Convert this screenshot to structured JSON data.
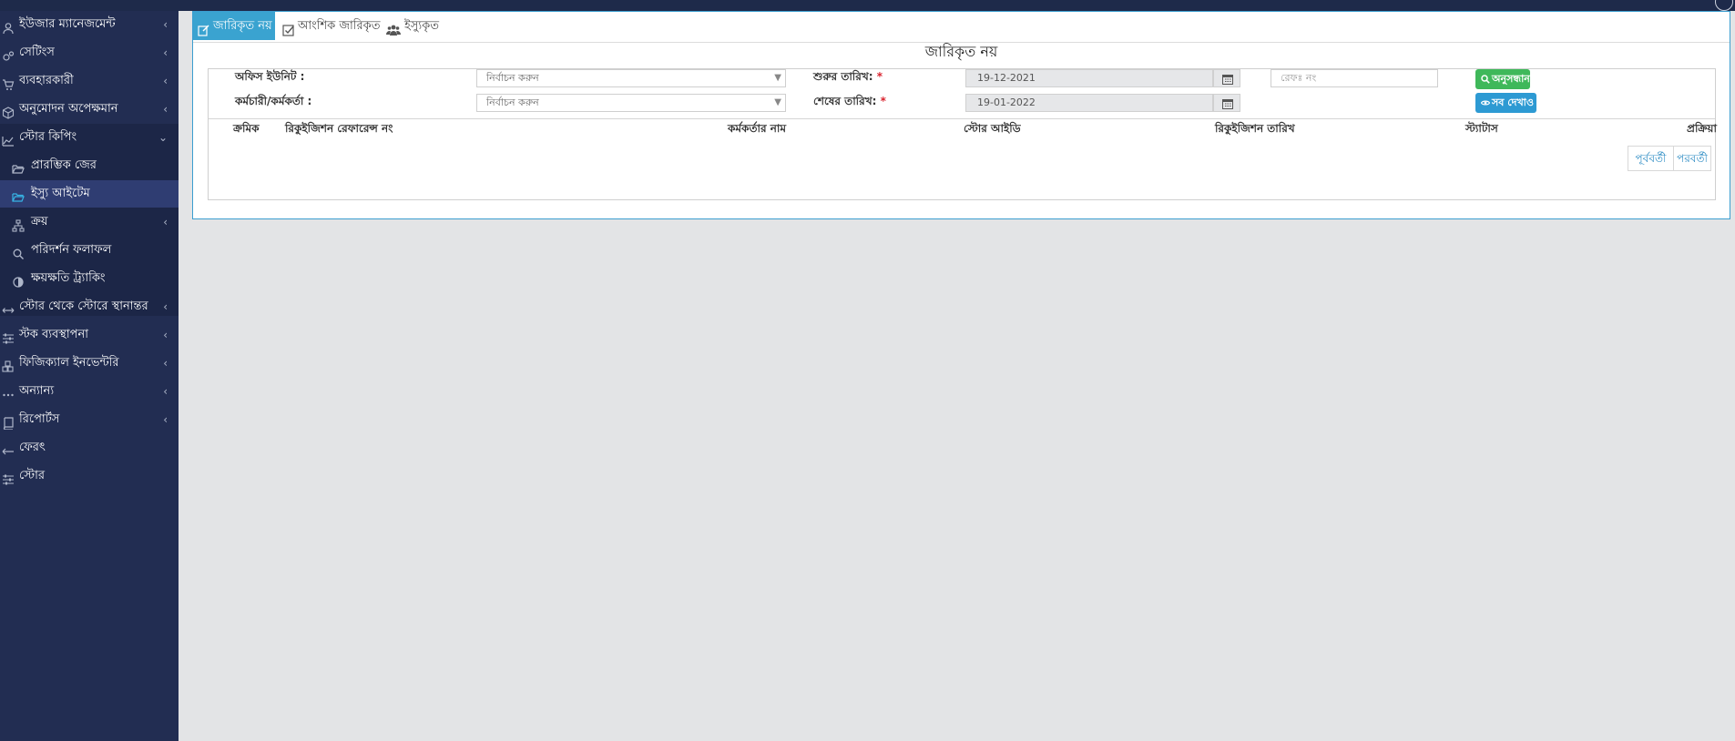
{
  "sidebar": {
    "items": [
      {
        "label": "ইউজার ম্যানেজমেন্ট",
        "icon": "user-icon",
        "chevron": "‹"
      },
      {
        "label": "সেটিংস",
        "icon": "gears-icon",
        "chevron": "‹"
      },
      {
        "label": "ব্যবহারকারী",
        "icon": "cart-icon",
        "chevron": "‹"
      },
      {
        "label": "অনুমোদন অপেক্ষমান",
        "icon": "cube-icon",
        "chevron": "‹"
      },
      {
        "label": "স্টোর কিপিং",
        "icon": "line-chart-icon",
        "chevron": "⌄"
      },
      {
        "label": "প্রারম্ভিক জের",
        "icon": "folder-open-icon"
      },
      {
        "label": "ইস্যু আইটেম",
        "icon": "folder-open-icon"
      },
      {
        "label": "ক্রয়",
        "icon": "sitemap-icon",
        "chevron": "‹"
      },
      {
        "label": "পরিদর্শন ফলাফল",
        "icon": "search-icon"
      },
      {
        "label": "ক্ষয়ক্ষতি ট্র্যাকিং",
        "icon": "adjust-icon"
      },
      {
        "label": "স্টোর থেকে স্টোরে স্থানান্তর",
        "icon": "arrows-h-icon",
        "chevron": "‹"
      },
      {
        "label": "স্টক ব্যবস্থাপনা",
        "icon": "sliders-icon",
        "chevron": "‹"
      },
      {
        "label": "ফিজিক্যাল ইনভেন্টরি",
        "icon": "cubes-icon",
        "chevron": "‹"
      },
      {
        "label": "অন্যান্য",
        "icon": "ellipsis-icon",
        "chevron": "‹"
      },
      {
        "label": "রিপোর্টস",
        "icon": "book-icon",
        "chevron": "‹"
      },
      {
        "label": "ফেরৎ",
        "icon": "arrow-left-icon"
      },
      {
        "label": "স্টোর",
        "icon": "sliders-icon"
      }
    ]
  },
  "tabs": [
    {
      "label": "জারিকৃত নয়",
      "icon": "edit-icon"
    },
    {
      "label": "আংশিক জারিকৃত",
      "icon": "check-square-icon"
    },
    {
      "label": "ইস্যুকৃত",
      "icon": "users-icon"
    }
  ],
  "page_title": "জারিকৃত নয়",
  "filters": {
    "office_unit_label": "অফিস ইউনিট :",
    "office_unit_value": "নির্বাচন করুন",
    "employee_label": "কর্মচারী/কর্মকর্তা :",
    "employee_value": "নির্বাচন করুন",
    "start_date_label": "শুরুর তারিখ:",
    "start_date_value": "19-12-2021",
    "end_date_label": "শেষের তারিখ:",
    "end_date_value": "19-01-2022",
    "required_mark": "*",
    "ref_placeholder": "রেফঃ নং",
    "search_button": "অনুসন্ধান",
    "show_all_button": "সব দেখাও"
  },
  "table": {
    "headers": [
      "ক্রমিক",
      "রিকুইজিশন রেফারেন্স নং",
      "কর্মকর্তার নাম",
      "স্টোর আইডি",
      "রিকুইজিশন তারিখ",
      "স্ট্যাটাস",
      "প্রক্রিয়া"
    ]
  },
  "pagination": {
    "previous": "পূর্ববর্তী",
    "next": "পরবর্তী"
  },
  "colors": {
    "sidebar_bg": "#222d52",
    "active_tab": "#3aa3d0",
    "search_button": "#3fb85a",
    "show_all_button": "#2d9ad3",
    "required": "#d9232e"
  }
}
